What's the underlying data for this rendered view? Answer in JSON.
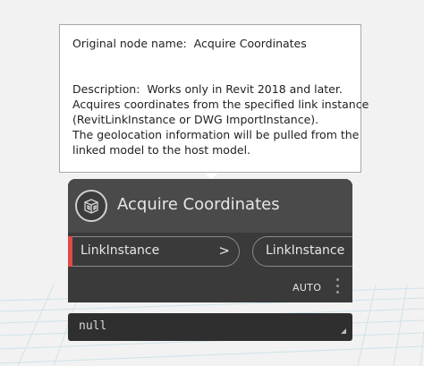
{
  "tooltip": {
    "original_name_line": "Original node name:  Acquire Coordinates",
    "description_lines": [
      "Description:  Works only in Revit 2018 and later.",
      "Acquires coordinates from the specified link instance",
      "(RevitLinkInstance or DWG ImportInstance).",
      "The geolocation information will be pulled from the",
      "linked model to the host model."
    ]
  },
  "node": {
    "title": "Acquire Coordinates",
    "icon": "revit-link-icon",
    "input_port": {
      "label": "LinkInstance",
      "chevron": ">"
    },
    "output_port": {
      "label": "LinkInstance"
    },
    "lacing": "AUTO"
  },
  "preview": {
    "value": "null"
  },
  "colors": {
    "node_body": "#3a3a3a",
    "node_header": "#4a4a4a",
    "input_accent": "#e04a4a",
    "preview_bg": "#2f2f2f",
    "workspace_bg": "#f2f2f2"
  }
}
